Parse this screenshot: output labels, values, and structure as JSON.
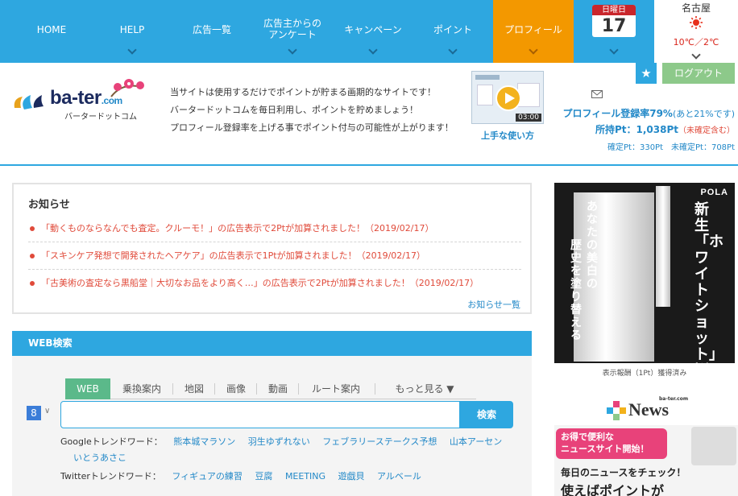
{
  "nav": {
    "items": [
      {
        "label": "HOME"
      },
      {
        "label": "HELP"
      },
      {
        "label": "広告一覧"
      },
      {
        "label": "広告主からの\nアンケート"
      },
      {
        "label": "キャンペーン"
      },
      {
        "label": "ポイント"
      },
      {
        "label": "プロフィール"
      }
    ],
    "active_item": "プロフィール",
    "active_color": "#f39800",
    "bar_color": "#2ea7e0"
  },
  "calendar": {
    "weekday": "日曜日",
    "day": "17"
  },
  "weather": {
    "city": "名古屋",
    "temp": "10℃／2℃",
    "icon": "sun-icon"
  },
  "header": {
    "logout_label": "ログアウト",
    "favorite_icon": "star-icon",
    "logo_text": "ba-ter",
    "logo_domain": ".com",
    "logo_sub": "バータードットコム",
    "intro": [
      "当サイトは使用するだけでポイントが貯まる画期的なサイトです！",
      "バータードットコムを毎日利用し、ポイントを貯めましょう！",
      "プロフィール登録率を上げる事でポイント付与の可能性が上がります！"
    ],
    "howto_label": "上手な使い方",
    "howto_duration": "03:00"
  },
  "profile": {
    "mail_icon": "mail-icon",
    "rate_label": "プロフィール登録率79%",
    "rate_note": "(あと21%です)",
    "points_label": "所持Pt：1,038Pt",
    "points_note": "（未確定含む）",
    "detail": "確定Pt：330Pt　未確定Pt：708Pt"
  },
  "notices": {
    "title": "お知らせ",
    "items": [
      "「動くものならなんでも査定。クルーモ！」の広告表示で2Ptが加算されました！（2019/02/17）",
      "「スキンケア発想で開発されたヘアケア」の広告表示で1Ptが加算されました！（2019/02/17）",
      "「古美術の査定なら黒船堂｜大切なお品をより高く…」の広告表示で2Ptが加算されました！（2019/02/17）"
    ],
    "more_label": "お知らせ一覧"
  },
  "web_search": {
    "title": "WEB検索",
    "tabs": [
      "WEB",
      "乗換案内",
      "地図",
      "画像",
      "動画",
      "ルート案内"
    ],
    "more_tab": "もっと見る ▼",
    "selected_tab": "WEB",
    "engine_icon": "google-plus-icon",
    "input_value": "",
    "button_label": "検索",
    "google_trend_label": "Googleトレンドワード：",
    "google_trends": [
      "熊本城マラソン",
      "羽生ゆずれない",
      "フェブラリーステークス予想",
      "山本アーセン",
      "いとうあさこ"
    ],
    "twitter_trend_label": "Twitterトレンドワード：",
    "twitter_trends": [
      "フィギュアの練習",
      "豆腐",
      "MEETING",
      "遊戯貝",
      "アルベール"
    ]
  },
  "sidebar": {
    "ad1": {
      "brand": "POLA",
      "headline_vertical": "新生「ホワイトショット」誕生",
      "copy_vertical_1": "あなたの美白の",
      "copy_vertical_2": "歴史を塗り替える",
      "caption": "表示報酬（1Pt）獲得済み"
    },
    "news_logo": {
      "small": "ba-ter.com",
      "text": "News"
    },
    "ad2": {
      "tag": "お得で便利な\nニュースサイト開始！",
      "line1": "毎日のニュースをチェック！",
      "line2": "使えばポイントが"
    }
  }
}
